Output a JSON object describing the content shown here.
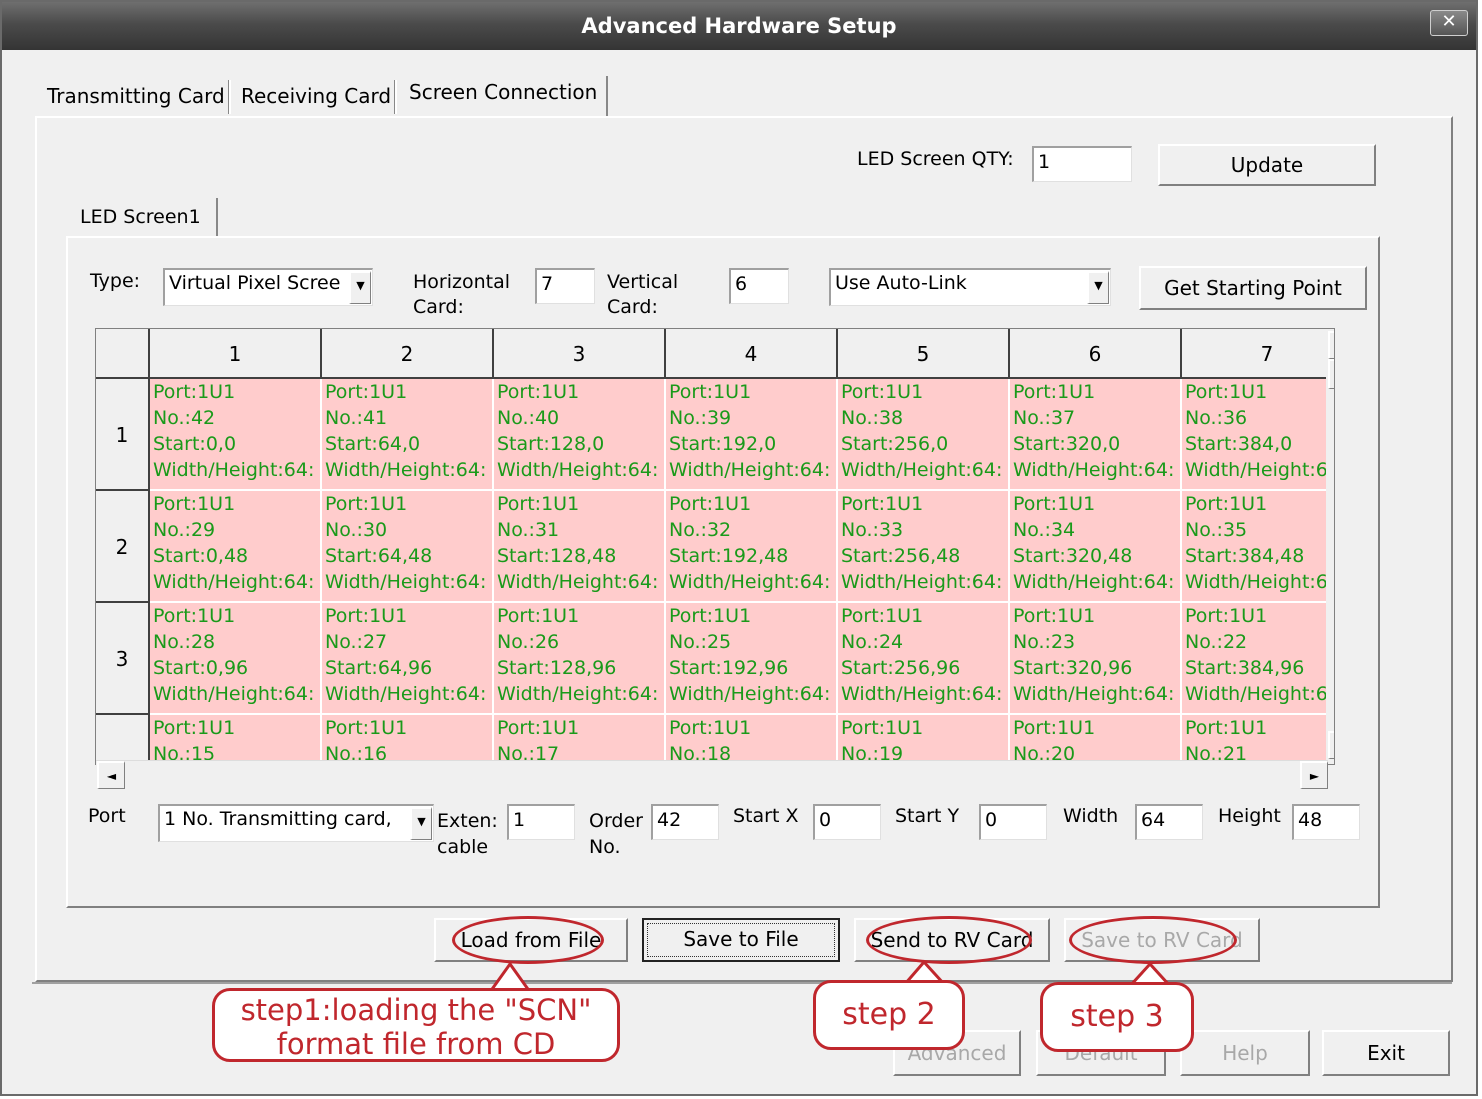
{
  "window": {
    "title": "Advanced Hardware Setup",
    "close": "✕"
  },
  "tabs": [
    "Transmitting Card",
    "Receiving Card",
    "Screen Connection"
  ],
  "qty": {
    "label": "LED Screen QTY:",
    "value": "1",
    "update_label": "Update"
  },
  "screen_tab": "LED Screen1",
  "config": {
    "type_label": "Type:",
    "type_value": "Virtual Pixel Scree",
    "hcard_label1": "Horizontal",
    "hcard_label2": "Card:",
    "hcard_value": "7",
    "vcard_label1": "Vertical",
    "vcard_label2": "Card:",
    "vcard_value": "6",
    "link_value": "Use Auto-Link",
    "starting_point_label": "Get Starting Point"
  },
  "grid": {
    "columns": [
      "1",
      "2",
      "3",
      "4",
      "5",
      "6",
      "7"
    ],
    "rows": [
      {
        "label": "1",
        "cells": [
          [
            "Port:1U1",
            "No.:42",
            "Start:0,0",
            "Width/Height:64:"
          ],
          [
            "Port:1U1",
            "No.:41",
            "Start:64,0",
            "Width/Height:64:"
          ],
          [
            "Port:1U1",
            "No.:40",
            "Start:128,0",
            "Width/Height:64:"
          ],
          [
            "Port:1U1",
            "No.:39",
            "Start:192,0",
            "Width/Height:64:"
          ],
          [
            "Port:1U1",
            "No.:38",
            "Start:256,0",
            "Width/Height:64:"
          ],
          [
            "Port:1U1",
            "No.:37",
            "Start:320,0",
            "Width/Height:64:"
          ],
          [
            "Port:1U1",
            "No.:36",
            "Start:384,0",
            "Width/Height:6"
          ]
        ]
      },
      {
        "label": "2",
        "cells": [
          [
            "Port:1U1",
            "No.:29",
            "Start:0,48",
            "Width/Height:64:"
          ],
          [
            "Port:1U1",
            "No.:30",
            "Start:64,48",
            "Width/Height:64:"
          ],
          [
            "Port:1U1",
            "No.:31",
            "Start:128,48",
            "Width/Height:64:"
          ],
          [
            "Port:1U1",
            "No.:32",
            "Start:192,48",
            "Width/Height:64:"
          ],
          [
            "Port:1U1",
            "No.:33",
            "Start:256,48",
            "Width/Height:64:"
          ],
          [
            "Port:1U1",
            "No.:34",
            "Start:320,48",
            "Width/Height:64:"
          ],
          [
            "Port:1U1",
            "No.:35",
            "Start:384,48",
            "Width/Height:6"
          ]
        ]
      },
      {
        "label": "3",
        "cells": [
          [
            "Port:1U1",
            "No.:28",
            "Start:0,96",
            "Width/Height:64:"
          ],
          [
            "Port:1U1",
            "No.:27",
            "Start:64,96",
            "Width/Height:64:"
          ],
          [
            "Port:1U1",
            "No.:26",
            "Start:128,96",
            "Width/Height:64:"
          ],
          [
            "Port:1U1",
            "No.:25",
            "Start:192,96",
            "Width/Height:64:"
          ],
          [
            "Port:1U1",
            "No.:24",
            "Start:256,96",
            "Width/Height:64:"
          ],
          [
            "Port:1U1",
            "No.:23",
            "Start:320,96",
            "Width/Height:64:"
          ],
          [
            "Port:1U1",
            "No.:22",
            "Start:384,96",
            "Width/Height:6"
          ]
        ]
      },
      {
        "label": "",
        "cells": [
          [
            "Port:1U1",
            "No.:15"
          ],
          [
            "Port:1U1",
            "No.:16"
          ],
          [
            "Port:1U1",
            "No.:17"
          ],
          [
            "Port:1U1",
            "No.:18"
          ],
          [
            "Port:1U1",
            "No.:19"
          ],
          [
            "Port:1U1",
            "No.:20"
          ],
          [
            "Port:1U1",
            "No.:21"
          ]
        ]
      }
    ]
  },
  "cell_props": {
    "port_label": "Port",
    "port_value": "1 No. Transmitting card,",
    "exten_label1": "Exten:",
    "exten_label2": "cable",
    "exten_value": "1",
    "order_label1": "Order",
    "order_label2": "No.",
    "order_value": "42",
    "startx_label": "Start X",
    "startx_value": "0",
    "starty_label": "Start Y",
    "starty_value": "0",
    "width_label": "Width",
    "width_value": "64",
    "height_label": "Height",
    "height_value": "48"
  },
  "actions": {
    "load": "Load from File",
    "save": "Save to File",
    "send": "Send to RV Card",
    "save_rv": "Save to RV Card"
  },
  "footer": {
    "advanced": "Advanced",
    "default": "Default",
    "help": "Help",
    "exit": "Exit"
  },
  "callouts": {
    "step1_line1": "step1:loading the \"SCN\"",
    "step1_line2": "format file from CD",
    "step2": "step 2",
    "step3": "step 3"
  },
  "colors": {
    "cell_bg": "#ffcccc",
    "cell_text": "#1a9a1a",
    "annotation": "#c0272d"
  },
  "icons": {
    "combo_arrow": "▼",
    "scroll_up": "▲",
    "scroll_down": "▼",
    "scroll_left": "◄",
    "scroll_right": "►"
  }
}
